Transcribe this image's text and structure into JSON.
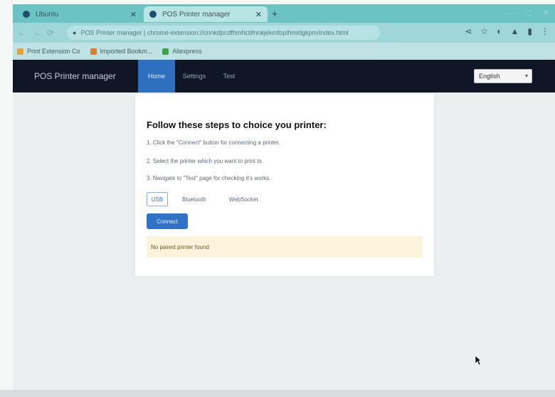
{
  "browser": {
    "tabs": [
      {
        "title": "Ubuntu",
        "active": false
      },
      {
        "title": "POS Printer manager",
        "active": true
      }
    ],
    "new_tab": "+",
    "window_controls": [
      "—",
      "□",
      "✕"
    ],
    "url": "POS Printer manager | chrome-extension://cnnkdpcdfhmhcbfnnkjekmfoplhmldgkpm/index.html",
    "bookmarks": [
      {
        "label": "Print Extension Co",
        "color": "#e0a53a"
      },
      {
        "label": "Imported Bookm...",
        "color": "#e07b2a"
      },
      {
        "label": "Aliexpress",
        "color": "#3aa34a"
      }
    ]
  },
  "app": {
    "brand": "POS Printer manager",
    "nav": [
      {
        "label": "Home",
        "active": true
      },
      {
        "label": "Settings",
        "active": false
      },
      {
        "label": "Test",
        "active": false
      }
    ],
    "language": "English",
    "heading": "Follow these steps to choice you printer:",
    "steps": [
      "1. Click the \"Connect\" button for connecting a printer.",
      "2. Select the printer which you want to print to.",
      "3. Navigate to \"Test\" page for checking it's works."
    ],
    "connection_types": [
      {
        "label": "USB",
        "active": true
      },
      {
        "label": "Bluetooth",
        "active": false
      },
      {
        "label": "WebSocket",
        "active": false
      }
    ],
    "connect_button": "Connect",
    "alert": "No paired printer found"
  }
}
